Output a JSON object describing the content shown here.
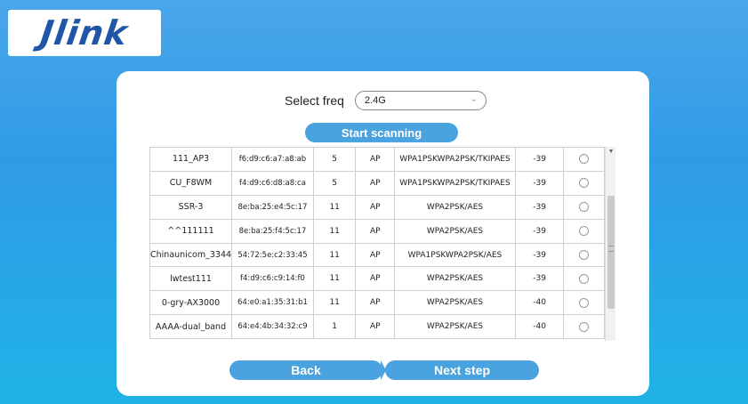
{
  "logo": {
    "text": "Jlink"
  },
  "freq": {
    "label": "Select freq",
    "selected": "2.4G"
  },
  "buttons": {
    "scan": "Start scanning",
    "back": "Back",
    "next": "Next step"
  },
  "networks": [
    {
      "ssid": "111_AP3",
      "mac": "f6:d9:c6:a7:a8:ab",
      "channel": "5",
      "mode": "AP",
      "security": "WPA1PSKWPA2PSK/TKIPAES",
      "rssi": "-39"
    },
    {
      "ssid": "CU_F8WM",
      "mac": "f4:d9:c6:d8:a8:ca",
      "channel": "5",
      "mode": "AP",
      "security": "WPA1PSKWPA2PSK/TKIPAES",
      "rssi": "-39"
    },
    {
      "ssid": "SSR-3",
      "mac": "8e:ba:25:e4:5c:17",
      "channel": "11",
      "mode": "AP",
      "security": "WPA2PSK/AES",
      "rssi": "-39"
    },
    {
      "ssid": "^^111111",
      "mac": "8e:ba:25:f4:5c:17",
      "channel": "11",
      "mode": "AP",
      "security": "WPA2PSK/AES",
      "rssi": "-39"
    },
    {
      "ssid": "Chinaunicom_3344",
      "mac": "54:72:5e:c2:33:45",
      "channel": "11",
      "mode": "AP",
      "security": "WPA1PSKWPA2PSK/AES",
      "rssi": "-39"
    },
    {
      "ssid": "lwtest111",
      "mac": "f4:d9:c6:c9:14:f0",
      "channel": "11",
      "mode": "AP",
      "security": "WPA2PSK/AES",
      "rssi": "-39"
    },
    {
      "ssid": "0-gry-AX3000",
      "mac": "64:e0:a1:35:31:b1",
      "channel": "11",
      "mode": "AP",
      "security": "WPA2PSK/AES",
      "rssi": "-40"
    },
    {
      "ssid": "AAAA-dual_band",
      "mac": "64:e4:4b:34:32:c9",
      "channel": "1",
      "mode": "AP",
      "security": "WPA2PSK/AES",
      "rssi": "-40"
    }
  ],
  "colors": {
    "accent": "#4aa3de",
    "logo": "#1f56a8",
    "background": "#2f9be6"
  }
}
